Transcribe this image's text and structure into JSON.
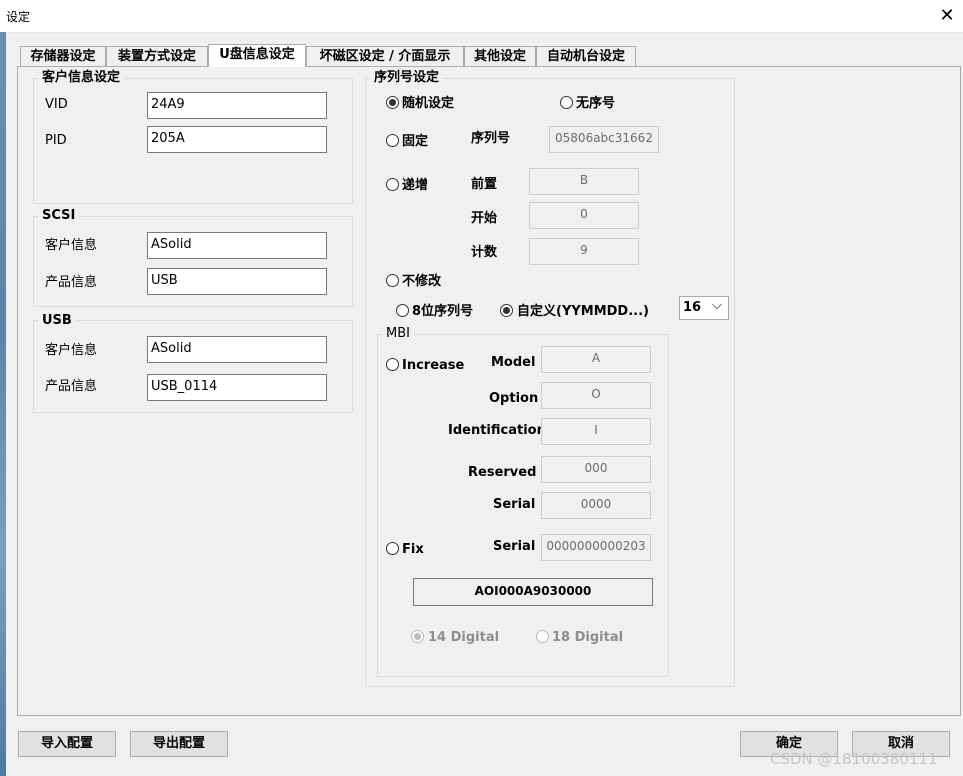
{
  "window": {
    "title": "设定",
    "close_glyph": "✕"
  },
  "tabs": [
    {
      "label": "存储器设定"
    },
    {
      "label": "装置方式设定"
    },
    {
      "label": "U盘信息设定"
    },
    {
      "label": "坏磁区设定 / 介面显示"
    },
    {
      "label": "其他设定"
    },
    {
      "label": "自动机台设定"
    }
  ],
  "customer": {
    "title": "客户信息设定",
    "vid_label": "VID",
    "vid_value": "24A9",
    "pid_label": "PID",
    "pid_value": "205A"
  },
  "scsi": {
    "title": "SCSI",
    "vendor_label": "客户信息",
    "vendor_value": "ASolid",
    "product_label": "产品信息",
    "product_value": "USB"
  },
  "usb": {
    "title": "USB",
    "vendor_label": "客户信息",
    "vendor_value": "ASolid",
    "product_label": "产品信息",
    "product_value": "USB_0114"
  },
  "serial": {
    "title": "序列号设定",
    "random_label": "随机设定",
    "no_serial_label": "无序号",
    "fixed_label": "固定",
    "serial_no_label": "序列号",
    "serial_no_value": "05806abc31662",
    "increment_label": "递增",
    "prefix_label": "前置",
    "prefix_value": "B",
    "start_label": "开始",
    "start_value": "0",
    "count_label": "计数",
    "count_value": "9",
    "nochange_label": "不修改",
    "eight_digit_label": "8位序列号",
    "custom_label": "自定义(YYMMDD...)",
    "length_value": "16",
    "dropdown_glyph": "⌵"
  },
  "mbi": {
    "title": "MBI",
    "increase_label": "Increase",
    "model_label": "Model",
    "model_value": "A",
    "option_label": "Option",
    "option_value": "O",
    "identification_label": "Identification",
    "identification_value": "I",
    "reserved_label": "Reserved",
    "reserved_value": "000",
    "serial_label": "Serial",
    "serial_value": "0000",
    "fix_label": "Fix",
    "fix_serial_label": "Serial",
    "fix_serial_value": "0000000000203",
    "result_value": "AOI000A9030000",
    "digit14_label": "14 Digital",
    "digit18_label": "18 Digital"
  },
  "buttons": {
    "import_label": "导入配置",
    "export_label": "导出配置",
    "ok_label": "确定",
    "cancel_label": "取消"
  },
  "watermark": "CSDN @18100380111"
}
